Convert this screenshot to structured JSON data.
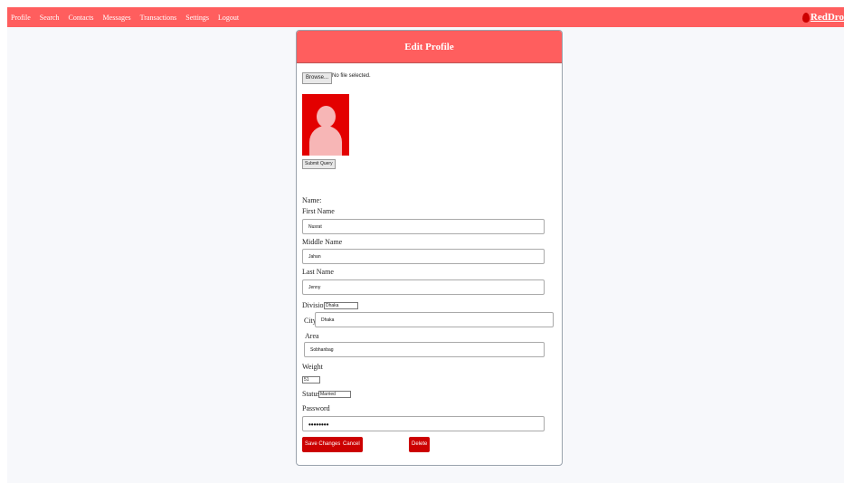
{
  "nav": {
    "links": [
      "Profile",
      "Search",
      "Contacts",
      "Messages",
      "Transactions",
      "Settings",
      "Logout"
    ],
    "brand": "RedDro"
  },
  "card": {
    "title": "Edit Profile",
    "browse_label": "Browse...",
    "file_status": "No file selected.",
    "submit_label": "Submit Query"
  },
  "form": {
    "name_label": "Name:",
    "first_name_label": "First Name",
    "first_name_value": "Nusrat",
    "middle_name_label": "Middle Name",
    "middle_name_value": "Jahan",
    "last_name_label": "Last Name",
    "last_name_value": "Jenny",
    "division_label": "Division",
    "division_value": "Dhaka",
    "city_label": "City",
    "city_value": "Dhaka",
    "area_label": "Area",
    "area_value": "Sobhanbag",
    "weight_label": "Weight",
    "weight_value": "51",
    "status_label": "Status",
    "status_value": "Married",
    "password_label": "Password",
    "password_value": "••••••••"
  },
  "buttons": {
    "save": "Save Changes",
    "cancel": "Cancel",
    "delete": "Delete"
  },
  "colors": {
    "navbar": "#ff5e5e",
    "button": "#cc0000",
    "avatar_bg": "#e30000"
  }
}
